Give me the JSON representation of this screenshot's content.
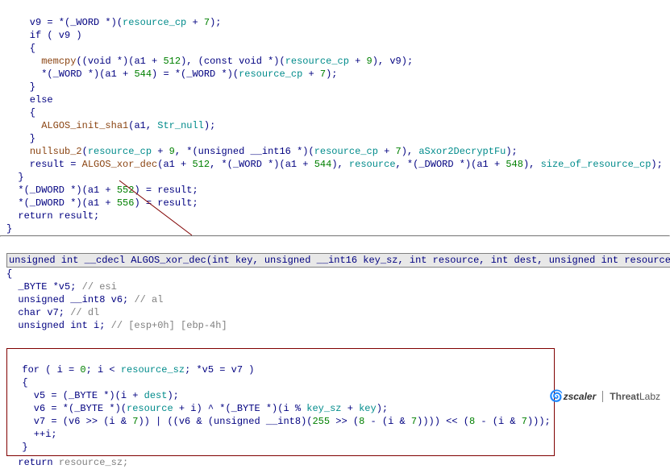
{
  "top": {
    "l1_a": "    v9 = *(_WORD *)(",
    "l1_b": "resource_cp",
    "l1_c": " + ",
    "l1_d": "7",
    "l1_e": ");",
    "l2": "    if ( v9 )",
    "l3": "    {",
    "l4_a": "      ",
    "l4_fn": "memcpy",
    "l4_b": "((void *)(a1 + ",
    "l4_n1": "512",
    "l4_c": "), (const void *)(",
    "l4_v": "resource_cp",
    "l4_d": " + ",
    "l4_n2": "9",
    "l4_e": "), v9);",
    "l5_a": "      *(_WORD *)(a1 + ",
    "l5_n1": "544",
    "l5_b": ") = *(_WORD *)(",
    "l5_v": "resource_cp",
    "l5_c": " + ",
    "l5_n2": "7",
    "l5_d": ");",
    "l6": "    }",
    "l7": "    else",
    "l8": "    {",
    "l9_a": "      ",
    "l9_fn": "ALGOS_init_sha1",
    "l9_b": "(a1, ",
    "l9_s": "Str_null",
    "l9_c": ");",
    "l10": "    }",
    "l11_a": "    ",
    "l11_fn": "nullsub_2",
    "l11_b": "(",
    "l11_v": "resource_cp",
    "l11_c": " + ",
    "l11_n1": "9",
    "l11_d": ", *(unsigned __int16 *)(",
    "l11_v2": "resource_cp",
    "l11_e": " + ",
    "l11_n2": "7",
    "l11_f": "), ",
    "l11_s": "aSxor2DecryptFu",
    "l11_g": ");",
    "l12_a": "    result = ",
    "l12_fn": "ALGOS_xor_dec",
    "l12_b": "(a1 + ",
    "l12_n1": "512",
    "l12_c": ", *(_WORD *)(a1 + ",
    "l12_n2": "544",
    "l12_d": "), ",
    "l12_v": "resource",
    "l12_e": ", *(_DWORD *)(a1 + ",
    "l12_n3": "548",
    "l12_f": "), ",
    "l12_v2": "size_of_resource_cp",
    "l12_g": ");",
    "l13": "  }",
    "l14_a": "  *(_DWORD *)(a1 + ",
    "l14_n": "552",
    "l14_b": ") = result;",
    "l15_a": "  *(_DWORD *)(a1 + ",
    "l15_n": "556",
    "l15_b": ") = result;",
    "l16": "  return result;",
    "l17": "}"
  },
  "bottom": {
    "sig": "unsigned int __cdecl ALGOS_xor_dec(int key, unsigned __int16 key_sz, int resource, int dest, unsigned int resource_sz)",
    "b1": "{",
    "b2_a": "  _BYTE *v5; ",
    "b2_c": "// esi",
    "b3_a": "  unsigned __int8 v6; ",
    "b3_c": "// al",
    "b4_a": "  char v7; ",
    "b4_c": "// dl",
    "b5_a": "  unsigned int i; ",
    "b5_c": "// [esp+0h] [ebp-4h]",
    "loop": {
      "f1_a": "  for ( i = ",
      "f1_n": "0",
      "f1_b": "; i < ",
      "f1_v": "resource_sz",
      "f1_c": "; *v5 = v7 )",
      "f2": "  {",
      "f3_a": "    v5 = (_BYTE *)(i + ",
      "f3_v": "dest",
      "f3_b": ");",
      "f4_a": "    v6 = *(_BYTE *)(",
      "f4_v1": "resource",
      "f4_b": " + i) ^ *(_BYTE *)(i % ",
      "f4_v2": "key_sz",
      "f4_c": " + ",
      "f4_v3": "key",
      "f4_d": ");",
      "f5_a": "    v7 = (v6 >> (i & ",
      "f5_n1": "7",
      "f5_b": ")) | ((v6 & (unsigned __int8)(",
      "f5_n2": "255",
      "f5_c": " >> (",
      "f5_n3": "8",
      "f5_d": " - (i & ",
      "f5_n4": "7",
      "f5_e": ")))) << (",
      "f5_n5": "8",
      "f5_f": " - (i & ",
      "f5_n6": "7",
      "f5_g": ")));",
      "f6": "    ++i;",
      "f7": "  }"
    },
    "ret_a": "  return ",
    "ret_v": "resource_sz",
    "ret_b": ";"
  },
  "footer": {
    "brand1": "zscaler",
    "brand2": "ThreatLabz"
  }
}
